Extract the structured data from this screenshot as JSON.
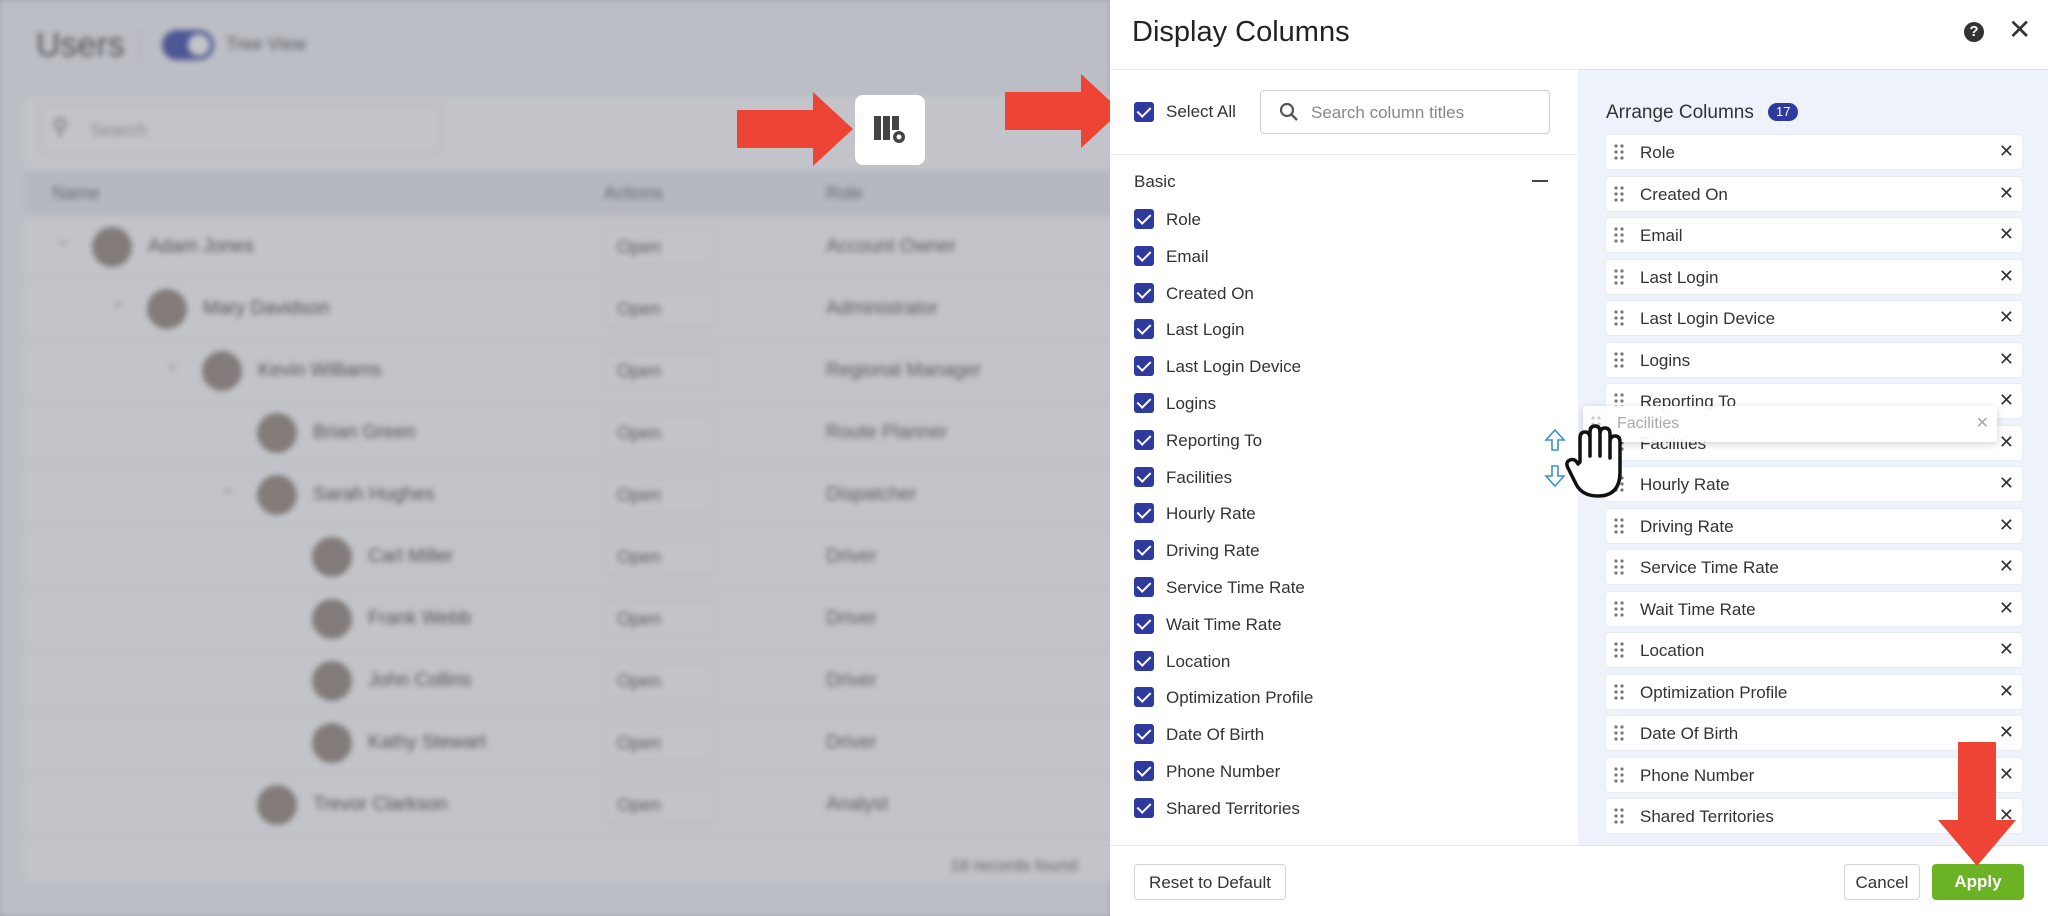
{
  "background": {
    "title": "Users",
    "tree_view_label": "Tree View",
    "search_placeholder": "Search",
    "columns": [
      "Name",
      "Actions",
      "Role"
    ],
    "rows": [
      {
        "name": "Adam Jones",
        "action": "Open",
        "role": "Account Owner"
      },
      {
        "name": "Mary Davidson",
        "action": "Open",
        "role": "Administrator"
      },
      {
        "name": "Kevin Williams",
        "action": "Open",
        "role": "Regional Manager"
      },
      {
        "name": "Brian Green",
        "action": "Open",
        "role": "Route Planner"
      },
      {
        "name": "Sarah Hughes",
        "action": "Open",
        "role": "Dispatcher"
      },
      {
        "name": "Carl Miller",
        "action": "Open",
        "role": "Driver"
      },
      {
        "name": "Frank Webb",
        "action": "Open",
        "role": "Driver"
      },
      {
        "name": "John Collins",
        "action": "Open",
        "role": "Driver"
      },
      {
        "name": "Kathy Stewart",
        "action": "Open",
        "role": "Driver"
      },
      {
        "name": "Trevor Clarkson",
        "action": "Open",
        "role": "Analyst"
      }
    ],
    "records_found": "18 records found"
  },
  "panel": {
    "title": "Display Columns",
    "select_all_label": "Select All",
    "search_placeholder": "Search column titles",
    "group_label": "Basic",
    "columns": [
      "Role",
      "Email",
      "Created On",
      "Last Login",
      "Last Login Device",
      "Logins",
      "Reporting To",
      "Facilities",
      "Hourly Rate",
      "Driving Rate",
      "Service Time Rate",
      "Wait Time Rate",
      "Location",
      "Optimization Profile",
      "Date Of Birth",
      "Phone Number",
      "Shared Territories"
    ],
    "arrange_title": "Arrange Columns",
    "arrange_count": "17",
    "arranged": [
      "Role",
      "Created On",
      "Email",
      "Last Login",
      "Last Login Device",
      "Logins",
      "Reporting To",
      "Facilities",
      "Hourly Rate",
      "Driving Rate",
      "Service Time Rate",
      "Wait Time Rate",
      "Location",
      "Optimization Profile",
      "Date Of Birth",
      "Phone Number",
      "Shared Territories"
    ],
    "dragging_item": "Facilities",
    "reset_label": "Reset to Default",
    "cancel_label": "Cancel",
    "apply_label": "Apply"
  },
  "colors": {
    "accent": "#2f3a9e",
    "apply": "#6bb325",
    "arrow": "#ee4435"
  },
  "icons": [
    "column-settings-icon",
    "search-icon",
    "help-icon",
    "close-icon",
    "drag-handle-icon",
    "remove-icon",
    "hand-cursor-icon",
    "sort-arrows-icon",
    "arrow-pointer-icon"
  ]
}
